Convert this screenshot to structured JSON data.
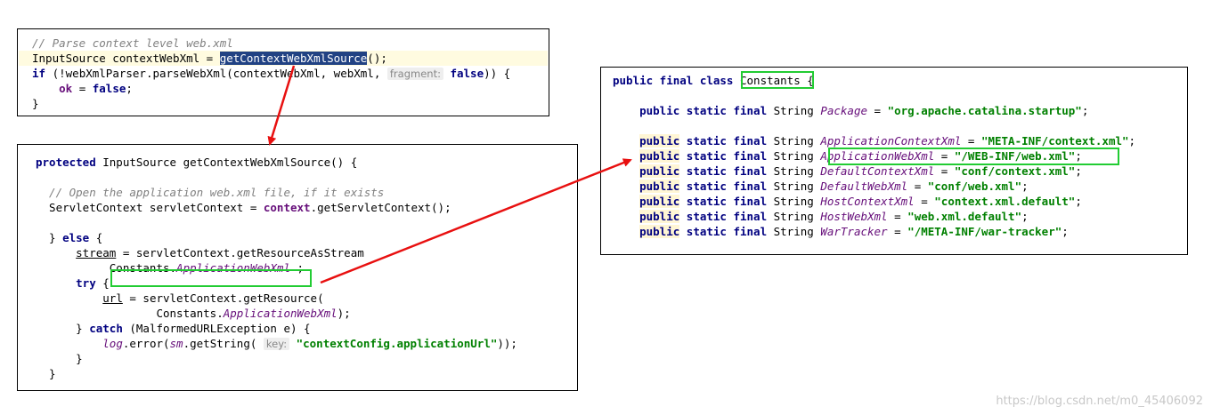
{
  "panel1": {
    "lines": [
      {
        "parts": [
          {
            "t": "// Parse context level web.xml",
            "c": "cm"
          }
        ]
      },
      {
        "parts": [
          {
            "t": "InputSource contextWebXml = ",
            "c": ""
          },
          {
            "t": "getContextWebXmlSource",
            "c": "sel"
          },
          {
            "t": "();",
            "c": ""
          }
        ]
      },
      {
        "parts": [
          {
            "t": "if",
            "c": "kw"
          },
          {
            "t": " (!webXmlParser.parseWebXml(contextWebXml, webXml, ",
            "c": ""
          },
          {
            "t": "fragment:",
            "c": "hint"
          },
          {
            "t": " false",
            "c": "kw"
          },
          {
            "t": ")) {",
            "c": ""
          }
        ]
      },
      {
        "parts": [
          {
            "t": "    ",
            "c": ""
          },
          {
            "t": "ok",
            "c": "fldb"
          },
          {
            "t": " = ",
            "c": ""
          },
          {
            "t": "false",
            "c": "kw"
          },
          {
            "t": ";",
            "c": ""
          }
        ]
      },
      {
        "parts": [
          {
            "t": "}",
            "c": ""
          }
        ]
      }
    ]
  },
  "panel2": {
    "lines": [
      {
        "parts": [
          {
            "t": "protected",
            "c": "kw"
          },
          {
            "t": " InputSource getContextWebXmlSource() {",
            "c": ""
          }
        ]
      },
      {
        "parts": [
          {
            "t": "",
            "c": ""
          }
        ]
      },
      {
        "parts": [
          {
            "t": "  // Open the application web.xml file, if it exists",
            "c": "cm"
          }
        ]
      },
      {
        "parts": [
          {
            "t": "  ServletContext servletContext = ",
            "c": ""
          },
          {
            "t": "context",
            "c": "fldb"
          },
          {
            "t": ".getServletContext();",
            "c": ""
          }
        ]
      },
      {
        "parts": [
          {
            "t": "",
            "c": ""
          }
        ]
      },
      {
        "parts": [
          {
            "t": "  } ",
            "c": ""
          },
          {
            "t": "else",
            "c": "kw"
          },
          {
            "t": " {",
            "c": ""
          }
        ]
      },
      {
        "parts": [
          {
            "t": "      ",
            "c": ""
          },
          {
            "t": "stream",
            "c": "ul"
          },
          {
            "t": " = servletContext.getResourceAsStream",
            "c": ""
          }
        ]
      },
      {
        "parts": [
          {
            "t": "           Constants.",
            "c": ""
          },
          {
            "t": "ApplicationWebXml",
            "c": "fld"
          },
          {
            "t": " ;",
            "c": ""
          }
        ]
      },
      {
        "parts": [
          {
            "t": "      ",
            "c": ""
          },
          {
            "t": "try",
            "c": "kw"
          },
          {
            "t": " {",
            "c": ""
          }
        ]
      },
      {
        "parts": [
          {
            "t": "          ",
            "c": ""
          },
          {
            "t": "url",
            "c": "ul"
          },
          {
            "t": " = servletContext.getResource(",
            "c": ""
          }
        ]
      },
      {
        "parts": [
          {
            "t": "                  Constants.",
            "c": ""
          },
          {
            "t": "ApplicationWebXml",
            "c": "fld"
          },
          {
            "t": ");",
            "c": ""
          }
        ]
      },
      {
        "parts": [
          {
            "t": "      } ",
            "c": ""
          },
          {
            "t": "catch",
            "c": "kw"
          },
          {
            "t": " (MalformedURLException e) {",
            "c": ""
          }
        ]
      },
      {
        "parts": [
          {
            "t": "          ",
            "c": ""
          },
          {
            "t": "log",
            "c": "fld"
          },
          {
            "t": ".error(",
            "c": ""
          },
          {
            "t": "sm",
            "c": "fld"
          },
          {
            "t": ".getString( ",
            "c": ""
          },
          {
            "t": "key:",
            "c": "hint"
          },
          {
            "t": " \"contextConfig.applicationUrl\"",
            "c": "str"
          },
          {
            "t": "));",
            "c": ""
          }
        ]
      },
      {
        "parts": [
          {
            "t": "      }",
            "c": ""
          }
        ]
      },
      {
        "parts": [
          {
            "t": "  }",
            "c": ""
          }
        ]
      }
    ]
  },
  "panel3": {
    "lines": [
      {
        "parts": [
          {
            "t": "public final class",
            "c": "kw"
          },
          {
            "t": " Constants ",
            "c": ""
          },
          {
            "t": "{",
            "c": ""
          }
        ]
      },
      {
        "parts": [
          {
            "t": "",
            "c": ""
          }
        ]
      },
      {
        "parts": [
          {
            "t": "    ",
            "c": ""
          },
          {
            "t": "public static final",
            "c": "kw"
          },
          {
            "t": " String ",
            "c": ""
          },
          {
            "t": "Package",
            "c": "fld"
          },
          {
            "t": " = ",
            "c": ""
          },
          {
            "t": "\"org.apache.catalina.startup\"",
            "c": "str"
          },
          {
            "t": ";",
            "c": ""
          }
        ]
      },
      {
        "parts": [
          {
            "t": "",
            "c": ""
          }
        ]
      },
      {
        "parts": [
          {
            "t": "    ",
            "c": ""
          },
          {
            "t": "public",
            "c": "kw kwbg"
          },
          {
            "t": " static final",
            "c": "kw"
          },
          {
            "t": " String ",
            "c": ""
          },
          {
            "t": "ApplicationContextXml",
            "c": "fld"
          },
          {
            "t": " = ",
            "c": ""
          },
          {
            "t": "\"META-INF/context.xml\"",
            "c": "str"
          },
          {
            "t": ";",
            "c": ""
          }
        ]
      },
      {
        "parts": [
          {
            "t": "    ",
            "c": ""
          },
          {
            "t": "public",
            "c": "kw kwbg"
          },
          {
            "t": " static final",
            "c": "kw"
          },
          {
            "t": " String ",
            "c": ""
          },
          {
            "t": "ApplicationWebXml",
            "c": "fld"
          },
          {
            "t": " = ",
            "c": ""
          },
          {
            "t": "\"/WEB-INF/web.xml\"",
            "c": "str"
          },
          {
            "t": ";",
            "c": ""
          }
        ]
      },
      {
        "parts": [
          {
            "t": "    ",
            "c": ""
          },
          {
            "t": "public",
            "c": "kw kwbg"
          },
          {
            "t": " static final",
            "c": "kw"
          },
          {
            "t": " String ",
            "c": ""
          },
          {
            "t": "DefaultContextXml",
            "c": "fld"
          },
          {
            "t": " = ",
            "c": ""
          },
          {
            "t": "\"conf/context.xml\"",
            "c": "str"
          },
          {
            "t": ";",
            "c": ""
          }
        ]
      },
      {
        "parts": [
          {
            "t": "    ",
            "c": ""
          },
          {
            "t": "public",
            "c": "kw kwbg"
          },
          {
            "t": " static final",
            "c": "kw"
          },
          {
            "t": " String ",
            "c": ""
          },
          {
            "t": "DefaultWebXml",
            "c": "fld"
          },
          {
            "t": " = ",
            "c": ""
          },
          {
            "t": "\"conf/web.xml\"",
            "c": "str"
          },
          {
            "t": ";",
            "c": ""
          }
        ]
      },
      {
        "parts": [
          {
            "t": "    ",
            "c": ""
          },
          {
            "t": "public",
            "c": "kw kwbg"
          },
          {
            "t": " static final",
            "c": "kw"
          },
          {
            "t": " String ",
            "c": ""
          },
          {
            "t": "HostContextXml",
            "c": "fld"
          },
          {
            "t": " = ",
            "c": ""
          },
          {
            "t": "\"context.xml.default\"",
            "c": "str"
          },
          {
            "t": ";",
            "c": ""
          }
        ]
      },
      {
        "parts": [
          {
            "t": "    ",
            "c": ""
          },
          {
            "t": "public",
            "c": "kw kwbg"
          },
          {
            "t": " static final",
            "c": "kw"
          },
          {
            "t": " String ",
            "c": ""
          },
          {
            "t": "HostWebXml",
            "c": "fld"
          },
          {
            "t": " = ",
            "c": ""
          },
          {
            "t": "\"web.xml.default\"",
            "c": "str"
          },
          {
            "t": ";",
            "c": ""
          }
        ]
      },
      {
        "parts": [
          {
            "t": "    ",
            "c": ""
          },
          {
            "t": "public",
            "c": "kw kwbg"
          },
          {
            "t": " static final",
            "c": "kw"
          },
          {
            "t": " String ",
            "c": ""
          },
          {
            "t": "WarTracker",
            "c": "fld"
          },
          {
            "t": " = ",
            "c": ""
          },
          {
            "t": "\"/META-INF/war-tracker\"",
            "c": "str"
          },
          {
            "t": ";",
            "c": ""
          }
        ]
      }
    ]
  },
  "watermark": "https://blog.csdn.net/m0_45406092",
  "colors": {
    "highlight_box": "#22cc33",
    "arrow": "#e81010"
  }
}
